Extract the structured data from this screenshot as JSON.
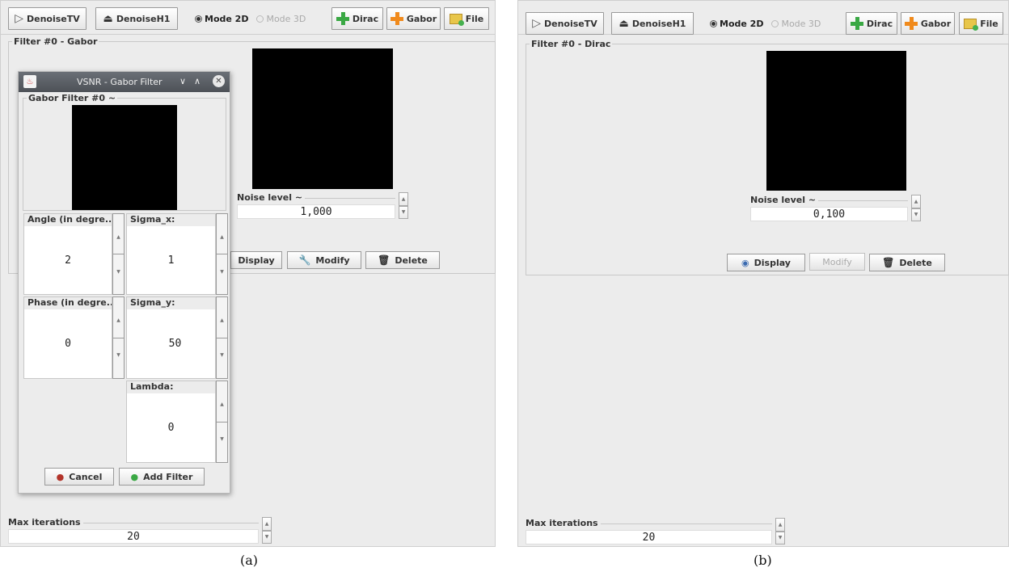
{
  "toolbar": {
    "denoise_tv": "DenoiseTV",
    "denoise_h1": "DenoiseH1",
    "mode_2d": "Mode 2D",
    "mode_3d": "Mode 3D",
    "dirac": "Dirac",
    "gabor": "Gabor",
    "file": "File"
  },
  "panel_a": {
    "filter_title": "Filter #0 - Gabor",
    "noise_label": "Noise level ~",
    "noise_value": "1,000",
    "display": "Display",
    "modify": "Modify",
    "delete": "Delete",
    "max_iter_label": "Max iterations",
    "max_iter_value": "20",
    "caption": "(a)"
  },
  "dialog": {
    "title": "VSNR - Gabor Filter",
    "preview_title": "Gabor Filter #0 ~",
    "angle_label": "Angle (in degre...",
    "angle_value": "2",
    "phase_label": "Phase (in degre...",
    "phase_value": "0",
    "sigma_x_label": "Sigma_x:",
    "sigma_x_value": "1",
    "sigma_y_label": "Sigma_y:",
    "sigma_y_value": "50",
    "lambda_label": "Lambda:",
    "lambda_value": "0",
    "cancel": "Cancel",
    "add_filter": "Add Filter"
  },
  "panel_b": {
    "filter_title": "Filter #0 - Dirac",
    "noise_label": "Noise level ~",
    "noise_value": "0,100",
    "display": "Display",
    "modify": "Modify",
    "delete": "Delete",
    "max_iter_label": "Max iterations",
    "max_iter_value": "20",
    "caption": "(b)"
  },
  "colors": {
    "panel_bg": "#ececec",
    "plus_green": "#3aa844",
    "plus_orange": "#f08a1c",
    "titlebar": "#54585e"
  }
}
